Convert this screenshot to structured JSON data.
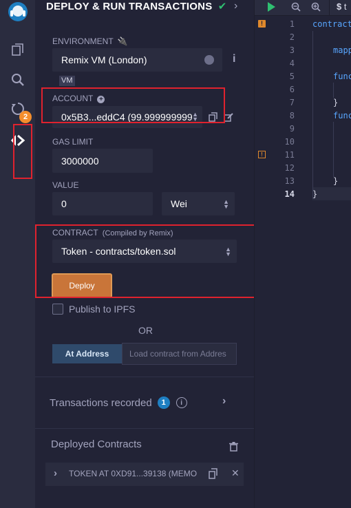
{
  "icon_panel": {
    "badge_count": "2"
  },
  "panel": {
    "title": "DEPLOY & RUN TRANSACTIONS",
    "environment": {
      "label": "ENVIRONMENT",
      "value": "Remix VM (London)",
      "tag": "VM"
    },
    "account": {
      "label": "ACCOUNT",
      "value": "0x5B3...eddC4 (99.999999999"
    },
    "gas_limit": {
      "label": "GAS LIMIT",
      "value": "3000000"
    },
    "value": {
      "label": "VALUE",
      "amount": "0",
      "unit": "Wei"
    },
    "contract": {
      "label": "CONTRACT",
      "compiled_by": "(Compiled by Remix)",
      "value": "Token - contracts/token.sol"
    },
    "deploy_button": "Deploy",
    "publish_ipfs": "Publish to IPFS",
    "or_text": "OR",
    "at_address_button": "At Address",
    "load_contract_placeholder": "Load contract from Addres",
    "transactions_recorded": {
      "label": "Transactions recorded",
      "count": "1"
    },
    "deployed_contracts": {
      "label": "Deployed Contracts",
      "item": "TOKEN AT 0XD91...39138 (MEMO"
    }
  },
  "editor": {
    "tab_label": "t",
    "line_numbers": [
      "1",
      "2",
      "3",
      "4",
      "5",
      "6",
      "7",
      "8",
      "9",
      "10",
      "11",
      "12",
      "13",
      "14"
    ],
    "code": {
      "l1": "contract",
      "l3": "mapp",
      "l5": "func",
      "l7": "}",
      "l8": "func",
      "l13": "}",
      "l14": "}"
    }
  }
}
